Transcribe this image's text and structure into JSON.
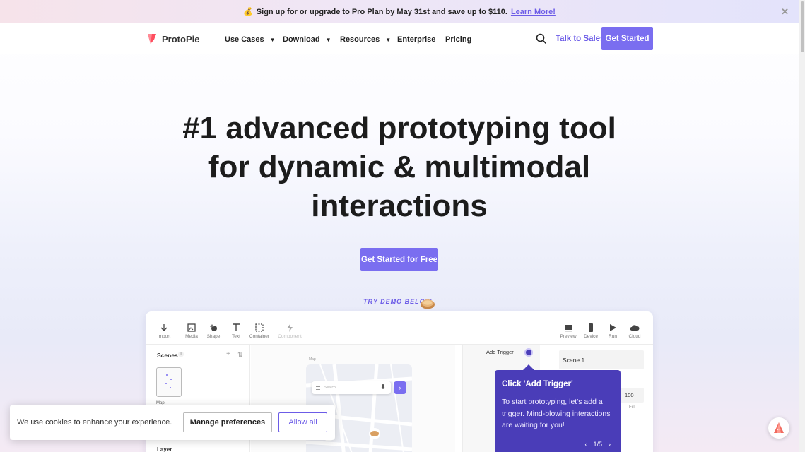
{
  "promo": {
    "emoji": "💰",
    "text": "Sign up for or upgrade to Pro Plan by May 31st and save up to $110.",
    "link": "Learn More!",
    "close": "✕"
  },
  "nav": {
    "brand": "ProtoPie",
    "items": [
      {
        "label": "Use Cases",
        "caret": "▼"
      },
      {
        "label": "Download",
        "caret": "▼"
      },
      {
        "label": "Resources",
        "caret": "▼"
      },
      {
        "label": "Enterprise"
      },
      {
        "label": "Pricing"
      }
    ],
    "talk_to_sales": "Talk to Sales",
    "get_started": "Get Started"
  },
  "hero": {
    "line1": "#1 advanced prototyping tool",
    "line2": "for dynamic & multimodal",
    "line3": "interactions",
    "cta": "Get Started for Free",
    "try_demo": "TRY DEMO BELOW"
  },
  "demo": {
    "tools": [
      "Import",
      "Media",
      "Shape",
      "Text",
      "Container",
      "Component"
    ],
    "right_tools": [
      "Preview",
      "Device",
      "Run",
      "Cloud"
    ],
    "scenes_label": "Scenes",
    "scenes_count": "1",
    "scene_thumb_label": "Map",
    "layer_label": "Layer",
    "canvas_title": "Map",
    "map_search_placeholder": "Search",
    "add_trigger": "Add Trigger",
    "scene_field": "Scene 1",
    "fill_value": "100",
    "fill_label": "Fill"
  },
  "tooltip": {
    "title": "Click 'Add Trigger'",
    "body": "To start prototyping, let's add a trigger. Mind-blowing interactions are waiting for you!",
    "pager": "1/5"
  },
  "cookie": {
    "text": "We use cookies to enhance your experience.",
    "manage": "Manage preferences",
    "allow": "Allow all"
  },
  "colors": {
    "accent": "#7a6ef0",
    "tooltip": "#4a3db8",
    "link": "#6c5ce7"
  }
}
